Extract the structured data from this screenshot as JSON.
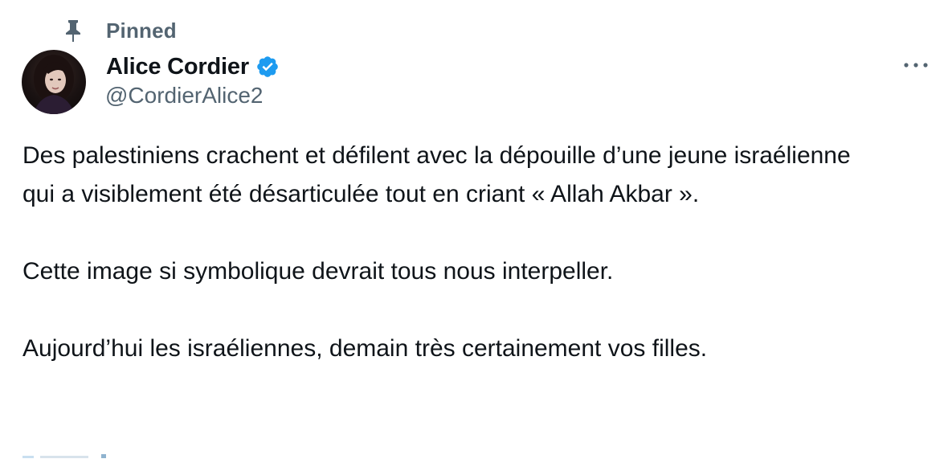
{
  "pinned": {
    "label": "Pinned",
    "icon": "pin-icon"
  },
  "author": {
    "display_name": "Alice Cordier",
    "handle": "@CordierAlice2",
    "verified": true,
    "verified_icon": "verified-badge-icon",
    "avatar_icon": "avatar"
  },
  "more_icon": "more-options-icon",
  "tweet": {
    "paragraphs": [
      "Des palestiniens crachent et défilent avec la dépouille d’une jeune israélienne qui a visiblement été désarticulée tout en criant « Allah Akbar ».",
      "Cette image si symbolique devrait tous nous interpeller.",
      "Aujourd’hui les israéliennes, demain très certainement vos filles."
    ]
  },
  "colors": {
    "text_primary": "#0f1419",
    "text_secondary": "#536471",
    "verified_blue": "#1d9bf0",
    "background": "#ffffff"
  }
}
